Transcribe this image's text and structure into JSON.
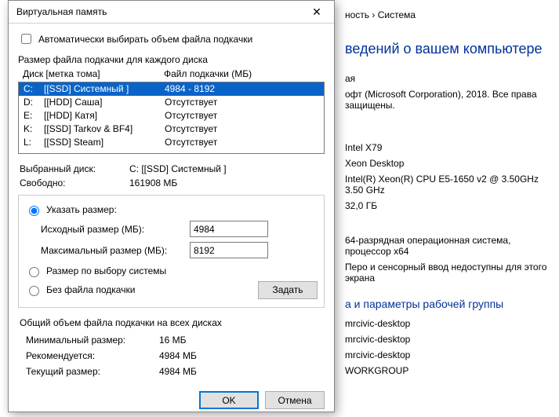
{
  "breadcrumb_suffix": "ность  ›  Система",
  "headline_suffix": "ведений о вашем компьютере",
  "sys": {
    "misc1_suffix": "ая",
    "copyright_suffix": "офт (Microsoft Corporation), 2018. Все права защищены.",
    "model": "Intel X79",
    "platform": "Xeon Desktop",
    "cpu": "Intel(R) Xeon(R) CPU E5-1650 v2 @ 3.50GHz   3.50 GHz",
    "ram": "32,0 ГБ",
    "os": "64-разрядная операционная система, процессор x64",
    "pen": "Перо и сенсорный ввод недоступны для этого экрана",
    "section_workgroup_suffix": "а и параметры рабочей группы",
    "pc1": "mrcivic-desktop",
    "pc2": "mrcivic-desktop",
    "pc3": "mrcivic-desktop",
    "workgroup": "WORKGROUP"
  },
  "dialog": {
    "title": "Виртуальная память",
    "auto_checkbox": "Автоматически выбирать объем файла подкачки",
    "group_label": "Размер файла подкачки для каждого диска",
    "col_disk": "Диск [метка тома]",
    "col_pf": "Файл подкачки (МБ)",
    "drives": [
      {
        "drive": "C:",
        "label": "[[SSD] Системный ]",
        "pf": "4984 - 8192",
        "selected": true
      },
      {
        "drive": "D:",
        "label": "[[HDD] Саша]",
        "pf": "Отсутствует",
        "selected": false
      },
      {
        "drive": "E:",
        "label": "[[HDD] Катя]",
        "pf": "Отсутствует",
        "selected": false
      },
      {
        "drive": "K:",
        "label": "[[SSD] Tarkov & BF4]",
        "pf": "Отсутствует",
        "selected": false
      },
      {
        "drive": "L:",
        "label": "[[SSD] Steam]",
        "pf": "Отсутствует",
        "selected": false
      }
    ],
    "selected_drive_label": "Выбранный диск:",
    "selected_drive_value": "C:  [[SSD] Системный ]",
    "free_label": "Свободно:",
    "free_value": "161908 МБ",
    "radio_custom": "Указать размер:",
    "initial_label": "Исходный размер (МБ):",
    "initial_value": "4984",
    "max_label": "Максимальный размер (МБ):",
    "max_value": "8192",
    "radio_system": "Размер по выбору системы",
    "radio_none": "Без файла подкачки",
    "set_btn": "Задать",
    "total_label": "Общий объем файла подкачки на всех дисках",
    "min_label": "Минимальный размер:",
    "min_value": "16 МБ",
    "rec_label": "Рекомендуется:",
    "rec_value": "4984 МБ",
    "cur_label": "Текущий размер:",
    "cur_value": "4984 МБ",
    "ok": "OK",
    "cancel": "Отмена"
  }
}
